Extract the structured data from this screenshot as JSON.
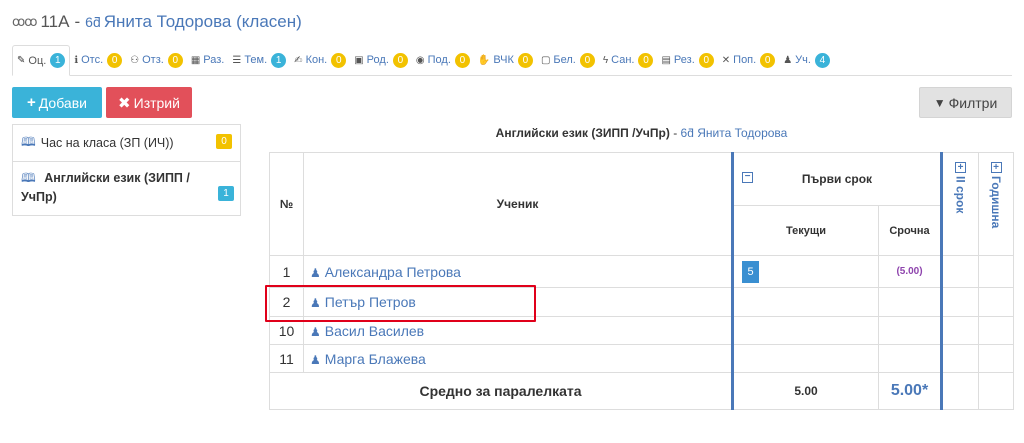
{
  "header": {
    "class_name": "11А",
    "separator": "-",
    "teacher": "Янита Тодорова (класен)"
  },
  "tabs": [
    {
      "label": "Оц.",
      "count": "1",
      "badge_color": "blue",
      "icon": "pencil-icon",
      "glyph": "✎"
    },
    {
      "label": "Отс.",
      "count": "0",
      "badge_color": "yellow",
      "icon": "info-circle-icon",
      "glyph": "ℹ"
    },
    {
      "label": "Отз.",
      "count": "0",
      "badge_color": "yellow",
      "icon": "award-icon",
      "glyph": "⚇"
    },
    {
      "label": "Раз.",
      "count": "",
      "badge_color": "",
      "icon": "table-icon",
      "glyph": "▦"
    },
    {
      "label": "Тем.",
      "count": "1",
      "badge_color": "blue",
      "icon": "list-icon",
      "glyph": "☰"
    },
    {
      "label": "Кон.",
      "count": "0",
      "badge_color": "yellow",
      "icon": "edit-icon",
      "glyph": "✍"
    },
    {
      "label": "Род.",
      "count": "0",
      "badge_color": "yellow",
      "icon": "calendar-icon",
      "glyph": "▣"
    },
    {
      "label": "Под.",
      "count": "0",
      "badge_color": "yellow",
      "icon": "eye-slash-icon",
      "glyph": "◉"
    },
    {
      "label": "ВЧК",
      "count": "0",
      "badge_color": "yellow",
      "icon": "handshake-icon",
      "glyph": "✋"
    },
    {
      "label": "Бел.",
      "count": "0",
      "badge_color": "yellow",
      "icon": "note-icon",
      "glyph": "▢"
    },
    {
      "label": "Сан.",
      "count": "0",
      "badge_color": "yellow",
      "icon": "bolt-icon",
      "glyph": "ϟ"
    },
    {
      "label": "Рез.",
      "count": "0",
      "badge_color": "yellow",
      "icon": "results-icon",
      "glyph": "▤"
    },
    {
      "label": "Поп.",
      "count": "0",
      "badge_color": "yellow",
      "icon": "tools-icon",
      "glyph": "✕"
    },
    {
      "label": "Уч.",
      "count": "4",
      "badge_color": "blue",
      "icon": "student-icon",
      "glyph": "♟"
    }
  ],
  "toolbar": {
    "add_label": "Добави",
    "delete_label": "Изтрий",
    "filter_label": "Филтри"
  },
  "subjects": [
    {
      "label": "Час на класа (ЗП (ИЧ))",
      "count": "0"
    },
    {
      "label": "Английски език (ЗИПП / УчПр)",
      "count": "1"
    }
  ],
  "table": {
    "title_subject": "Английски език (ЗИПП /УчПр)",
    "title_sep": "-",
    "title_teacher": "Янита Тодорова",
    "col_no": "№",
    "col_student": "Ученик",
    "term1": "Първи срок",
    "term2": "II срок",
    "year": "Годишна",
    "col_current": "Текущи",
    "col_term_grade": "Срочна",
    "rows": [
      {
        "no": "1",
        "name": "Александра Петрова",
        "current": "5",
        "term_grade": "(5.00)"
      },
      {
        "no": "2",
        "name": "Петър Петров",
        "current": "",
        "term_grade": ""
      },
      {
        "no": "10",
        "name": "Васил Василев",
        "current": "",
        "term_grade": ""
      },
      {
        "no": "11",
        "name": "Марга Блажева",
        "current": "",
        "term_grade": ""
      }
    ],
    "summary_label": "Средно за паралелката",
    "summary_current": "5.00",
    "summary_term": "5.00*"
  }
}
